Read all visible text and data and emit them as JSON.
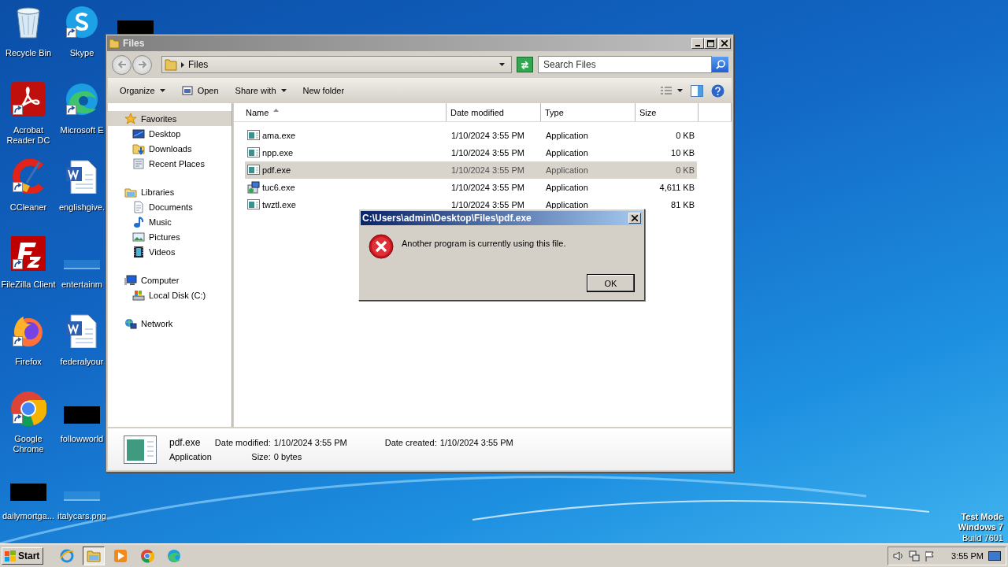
{
  "desktop": {
    "icons": [
      {
        "label": "Recycle Bin",
        "kind": "recycle",
        "shortcut": false
      },
      {
        "label": "Acrobat Reader DC",
        "kind": "acrobat",
        "shortcut": true
      },
      {
        "label": "CCleaner",
        "kind": "ccleaner",
        "shortcut": true
      },
      {
        "label": "FileZilla Client",
        "kind": "filezilla",
        "shortcut": true
      },
      {
        "label": "Firefox",
        "kind": "firefox",
        "shortcut": true
      },
      {
        "label": "Google Chrome",
        "kind": "chrome",
        "shortcut": true
      },
      {
        "label": "dailymortga...",
        "kind": "dark",
        "shortcut": false
      },
      {
        "label": "Skype",
        "kind": "skype",
        "shortcut": true
      },
      {
        "label": "Microsoft E",
        "kind": "edge",
        "shortcut": true
      },
      {
        "label": "englishgive.",
        "kind": "word",
        "shortcut": false
      },
      {
        "label": "entertainm",
        "kind": "blank",
        "shortcut": false
      },
      {
        "label": "federalyour",
        "kind": "word",
        "shortcut": false
      },
      {
        "label": "followworld",
        "kind": "dark",
        "shortcut": false
      },
      {
        "label": "italycars.png",
        "kind": "blank",
        "shortcut": false
      },
      {
        "kind": "dark",
        "shortcut": false
      }
    ],
    "watermark_text": [
      "Test Mode",
      "Windows 7",
      "Build 7601"
    ]
  },
  "explorer": {
    "title": "Files",
    "address": "Files",
    "search": {
      "placeholder": "Search Files"
    },
    "toolbar": [
      {
        "label": "Organize",
        "kind": "menu"
      },
      {
        "label": "Open",
        "kind": "open"
      },
      {
        "label": "Share with",
        "kind": "menu"
      },
      {
        "label": "New folder",
        "kind": "plain"
      }
    ],
    "sidebar": [
      {
        "label": "Favorites",
        "kind": "star",
        "selected": true,
        "children": [
          {
            "label": "Desktop",
            "kind": "desktop",
            "selected": false
          },
          {
            "label": "Downloads",
            "kind": "downloads",
            "selected": false
          },
          {
            "label": "Recent Places",
            "kind": "recent",
            "selected": false
          }
        ]
      },
      {
        "label": "Libraries",
        "kind": "library",
        "selected": false,
        "children": [
          {
            "label": "Documents",
            "kind": "documents",
            "selected": false
          },
          {
            "label": "Music",
            "kind": "music",
            "selected": false
          },
          {
            "label": "Pictures",
            "kind": "pictures",
            "selected": false
          },
          {
            "label": "Videos",
            "kind": "videos",
            "selected": false
          }
        ]
      },
      {
        "label": "Computer",
        "kind": "computer",
        "selected": false,
        "children": [
          {
            "label": "Local Disk (C:)",
            "kind": "disk",
            "selected": false
          }
        ]
      },
      {
        "label": "Network",
        "kind": "network",
        "selected": false
      }
    ],
    "columns": [
      {
        "label": "Name",
        "sorted": true
      },
      {
        "label": "Date modified",
        "sorted": false
      },
      {
        "label": "Type",
        "sorted": false
      },
      {
        "label": "Size",
        "sorted": false
      }
    ],
    "rows": [
      {
        "name": "ama.exe",
        "date": "1/10/2024 3:55 PM",
        "type": "Application",
        "size": "0 KB",
        "kind": "app",
        "selected": false
      },
      {
        "name": "npp.exe",
        "date": "1/10/2024 3:55 PM",
        "type": "Application",
        "size": "10 KB",
        "kind": "app",
        "selected": false
      },
      {
        "name": "pdf.exe",
        "date": "1/10/2024 3:55 PM",
        "type": "Application",
        "size": "0 KB",
        "kind": "app",
        "selected": true
      },
      {
        "name": "tuc6.exe",
        "date": "1/10/2024 3:55 PM",
        "type": "Application",
        "size": "4,611 KB",
        "kind": "installer",
        "selected": false
      },
      {
        "name": "twztl.exe",
        "date": "1/10/2024 3:55 PM",
        "type": "Application",
        "size": "81 KB",
        "kind": "app",
        "selected": false
      }
    ],
    "details": {
      "name": "pdf.exe",
      "type": "Application",
      "fields": [
        {
          "label": "Date modified:",
          "value": "1/10/2024 3:55 PM"
        },
        {
          "label": "Date created:",
          "value": "1/10/2024 3:55 PM"
        },
        {
          "label": "Size:",
          "value": "0 bytes"
        }
      ]
    }
  },
  "dialog": {
    "title": "C:\\Users\\admin\\Desktop\\Files\\pdf.exe",
    "message": "Another program is currently using this file.",
    "button": "OK"
  },
  "taskbar": {
    "start": "Start",
    "items": [
      {
        "kind": "ie",
        "selected": false
      },
      {
        "kind": "explorer",
        "selected": true
      },
      {
        "kind": "media",
        "selected": false
      },
      {
        "kind": "chrome",
        "selected": false
      },
      {
        "kind": "edge",
        "selected": false
      }
    ],
    "clock": "3:55 PM"
  }
}
